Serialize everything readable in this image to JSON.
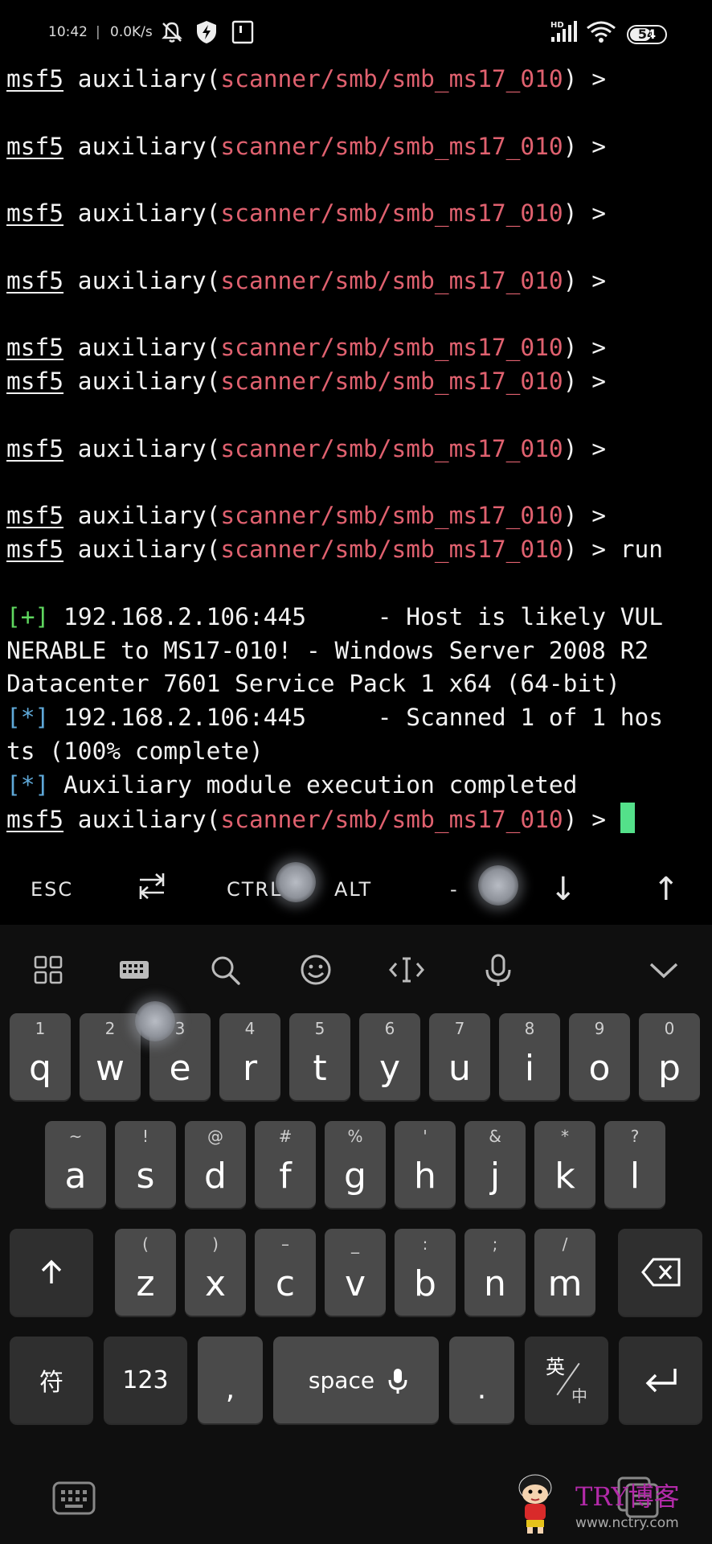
{
  "status_bar": {
    "time": "10:42",
    "net_speed": "0.0K/s",
    "battery": "54",
    "icons": [
      "mute-icon",
      "shield-icon",
      "sim-icon",
      "hd-signal-icon",
      "wifi-icon",
      "battery-icon"
    ]
  },
  "terminal": {
    "prompt_user": "msf5",
    "prompt_module": "scanner/smb/smb_ms17_010",
    "lines": [
      {
        "type": "prompt",
        "cmd": ""
      },
      {
        "type": "blank"
      },
      {
        "type": "prompt",
        "cmd": ""
      },
      {
        "type": "blank"
      },
      {
        "type": "prompt",
        "cmd": ""
      },
      {
        "type": "blank"
      },
      {
        "type": "prompt",
        "cmd": ""
      },
      {
        "type": "blank"
      },
      {
        "type": "prompt",
        "cmd": ""
      },
      {
        "type": "prompt",
        "cmd": ""
      },
      {
        "type": "blank"
      },
      {
        "type": "prompt",
        "cmd": ""
      },
      {
        "type": "blank"
      },
      {
        "type": "prompt",
        "cmd": ""
      },
      {
        "type": "prompt",
        "cmd": "run"
      },
      {
        "type": "blank"
      },
      {
        "type": "out",
        "tag": "[+]",
        "tag_color": "plus",
        "text": " 192.168.2.106:445     - Host is likely VUL"
      },
      {
        "type": "out",
        "tag": "",
        "text": "NERABLE to MS17-010! - Windows Server 2008 R2"
      },
      {
        "type": "out",
        "tag": "",
        "text": "Datacenter 7601 Service Pack 1 x64 (64-bit)"
      },
      {
        "type": "out",
        "tag": "[*]",
        "tag_color": "star",
        "text": " 192.168.2.106:445     - Scanned 1 of 1 hos"
      },
      {
        "type": "out",
        "tag": "",
        "text": "ts (100% complete)"
      },
      {
        "type": "out",
        "tag": "[*]",
        "tag_color": "star",
        "text": " Auxiliary module execution completed"
      },
      {
        "type": "prompt",
        "cmd": "",
        "cursor": true
      }
    ]
  },
  "extra_keys": {
    "esc": "ESC",
    "tab_icon": "tab-arrows-icon",
    "ctrl": "CTRL",
    "alt": "ALT",
    "dash": "-",
    "down": "↓",
    "up": "↑"
  },
  "keyboard": {
    "toolbar_icons": [
      "grid-icon",
      "keyboard-layout-icon",
      "search-icon",
      "emoji-icon",
      "cursor-move-icon",
      "microphone-icon",
      "collapse-chevron-icon"
    ],
    "row1": [
      [
        "1",
        "q"
      ],
      [
        "2",
        "w"
      ],
      [
        "3",
        "e"
      ],
      [
        "4",
        "r"
      ],
      [
        "5",
        "t"
      ],
      [
        "6",
        "y"
      ],
      [
        "7",
        "u"
      ],
      [
        "8",
        "i"
      ],
      [
        "9",
        "o"
      ],
      [
        "0",
        "p"
      ]
    ],
    "row2": [
      [
        "~",
        "a"
      ],
      [
        "!",
        "s"
      ],
      [
        "@",
        "d"
      ],
      [
        "#",
        "f"
      ],
      [
        "%",
        "g"
      ],
      [
        "'",
        "h"
      ],
      [
        "&",
        "j"
      ],
      [
        "*",
        "k"
      ],
      [
        "?",
        "l"
      ]
    ],
    "row3": [
      [
        "(",
        "z"
      ],
      [
        ")",
        "x"
      ],
      [
        "–",
        "c"
      ],
      [
        "_",
        "v"
      ],
      [
        ":",
        "b"
      ],
      [
        ";",
        "n"
      ],
      [
        "/",
        "m"
      ]
    ],
    "shift_icon": "shift-arrow-icon",
    "backspace_icon": "backspace-icon",
    "symbol_label": "符",
    "num_label": "123",
    "comma_label": ",",
    "space_label": "space",
    "period_label": ".",
    "lang_top": "英",
    "lang_bottom": "中",
    "enter_icon": "enter-icon",
    "bottom_left_icon": "keyboard-icon",
    "bottom_right_icon": "clipboard-icon"
  },
  "watermark": {
    "brand": "TRY博客",
    "url": "www.nctry.com"
  }
}
